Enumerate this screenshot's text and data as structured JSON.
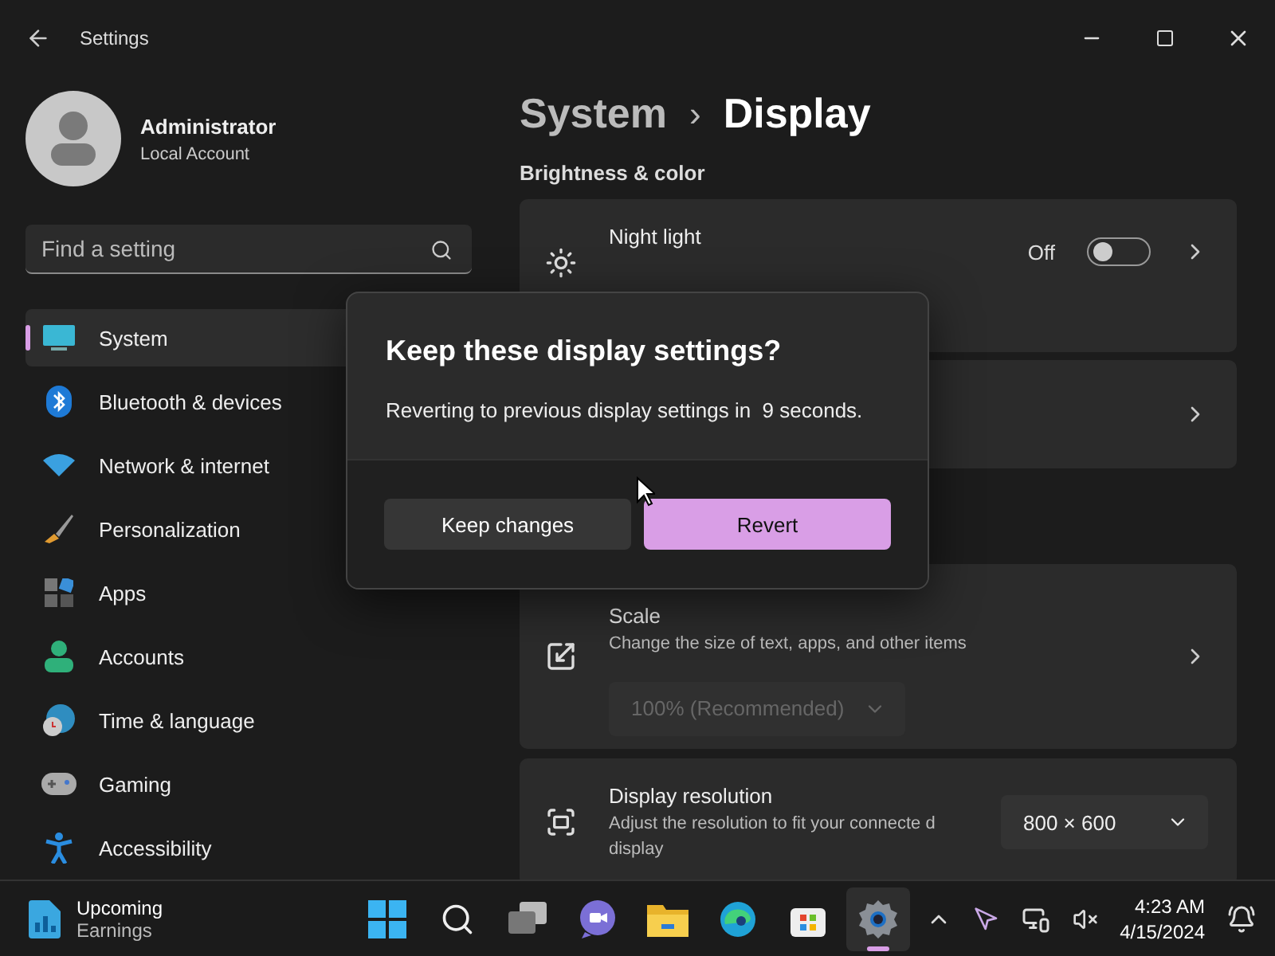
{
  "window": {
    "title": "Settings"
  },
  "account": {
    "name": "Administrator",
    "type": "Local Account"
  },
  "search": {
    "placeholder": "Find a setting"
  },
  "sidebar": {
    "items": [
      {
        "label": "System",
        "selected": true
      },
      {
        "label": "Bluetooth & devices",
        "selected": false
      },
      {
        "label": "Network & internet",
        "selected": false
      },
      {
        "label": "Personalization",
        "selected": false
      },
      {
        "label": "Apps",
        "selected": false
      },
      {
        "label": "Accounts",
        "selected": false
      },
      {
        "label": "Time & language",
        "selected": false
      },
      {
        "label": "Gaming",
        "selected": false
      },
      {
        "label": "Accessibility",
        "selected": false
      }
    ]
  },
  "breadcrumb": {
    "parent": "System",
    "separator": "›",
    "current": "Display"
  },
  "section": "Brightness & color",
  "cards": [
    {
      "kind": "toggle",
      "title": "Night light",
      "state_label": "Off",
      "on": false
    },
    {
      "kind": "link"
    },
    {
      "kind": "stacked",
      "title": "Scale",
      "description": "Change the size of text, apps, and other items",
      "value": "100% (Recommended)",
      "disabled": true
    },
    {
      "kind": "inline",
      "title": "Display resolution",
      "description": "Adjust the resolution to fit your connecte d display",
      "value": "800 × 600",
      "disabled": false
    }
  ],
  "dialog": {
    "title": "Keep these display settings?",
    "message": "Reverting to previous display settings in  9 seconds.",
    "buttons": [
      {
        "label": "Keep changes",
        "primary": false
      },
      {
        "label": "Revert",
        "primary": true
      }
    ]
  },
  "taskbar": {
    "widget": {
      "title": "Upcoming",
      "subtitle": "Earnings"
    },
    "apps": [
      {
        "selected": false
      },
      {
        "selected": false
      },
      {
        "selected": false
      },
      {
        "selected": false
      },
      {
        "selected": false
      },
      {
        "selected": false
      },
      {
        "selected": false
      },
      {
        "selected": true
      }
    ],
    "time": "4:23 AM",
    "date": "4/15/2024"
  }
}
